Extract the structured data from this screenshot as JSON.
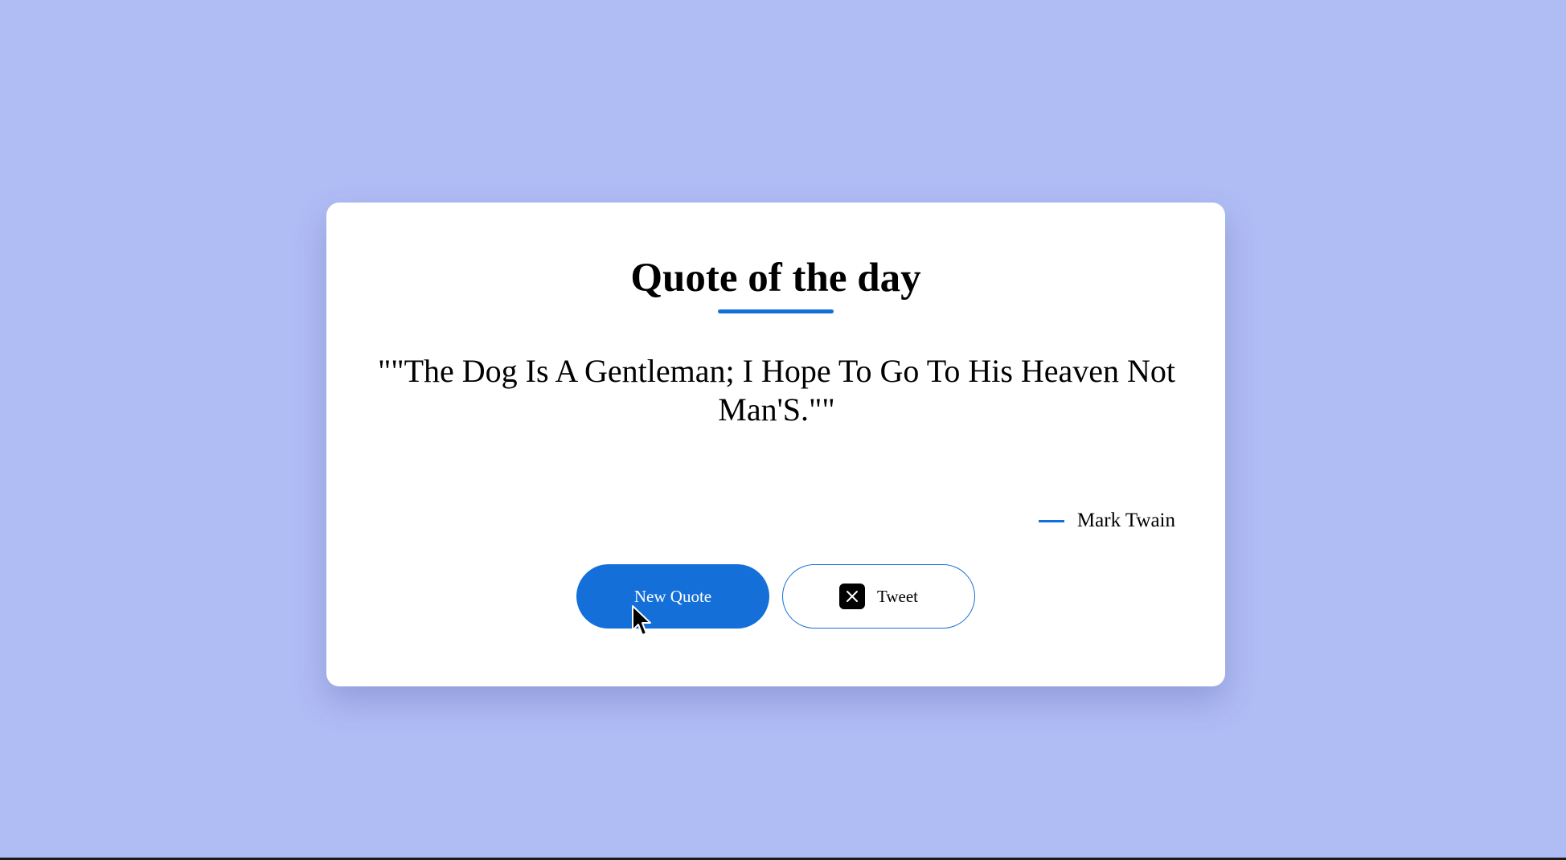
{
  "card": {
    "title": "Quote of the day",
    "quote": "\"\"The Dog Is A Gentleman; I Hope To Go To His Heaven Not Man'S.\"\"",
    "author": "Mark Twain"
  },
  "buttons": {
    "new_quote_label": "New Quote",
    "tweet_label": "Tweet",
    "tweet_icon": "x-logo-icon"
  },
  "colors": {
    "background": "#b0bcf4",
    "accent": "#1470d8",
    "card": "#ffffff"
  }
}
